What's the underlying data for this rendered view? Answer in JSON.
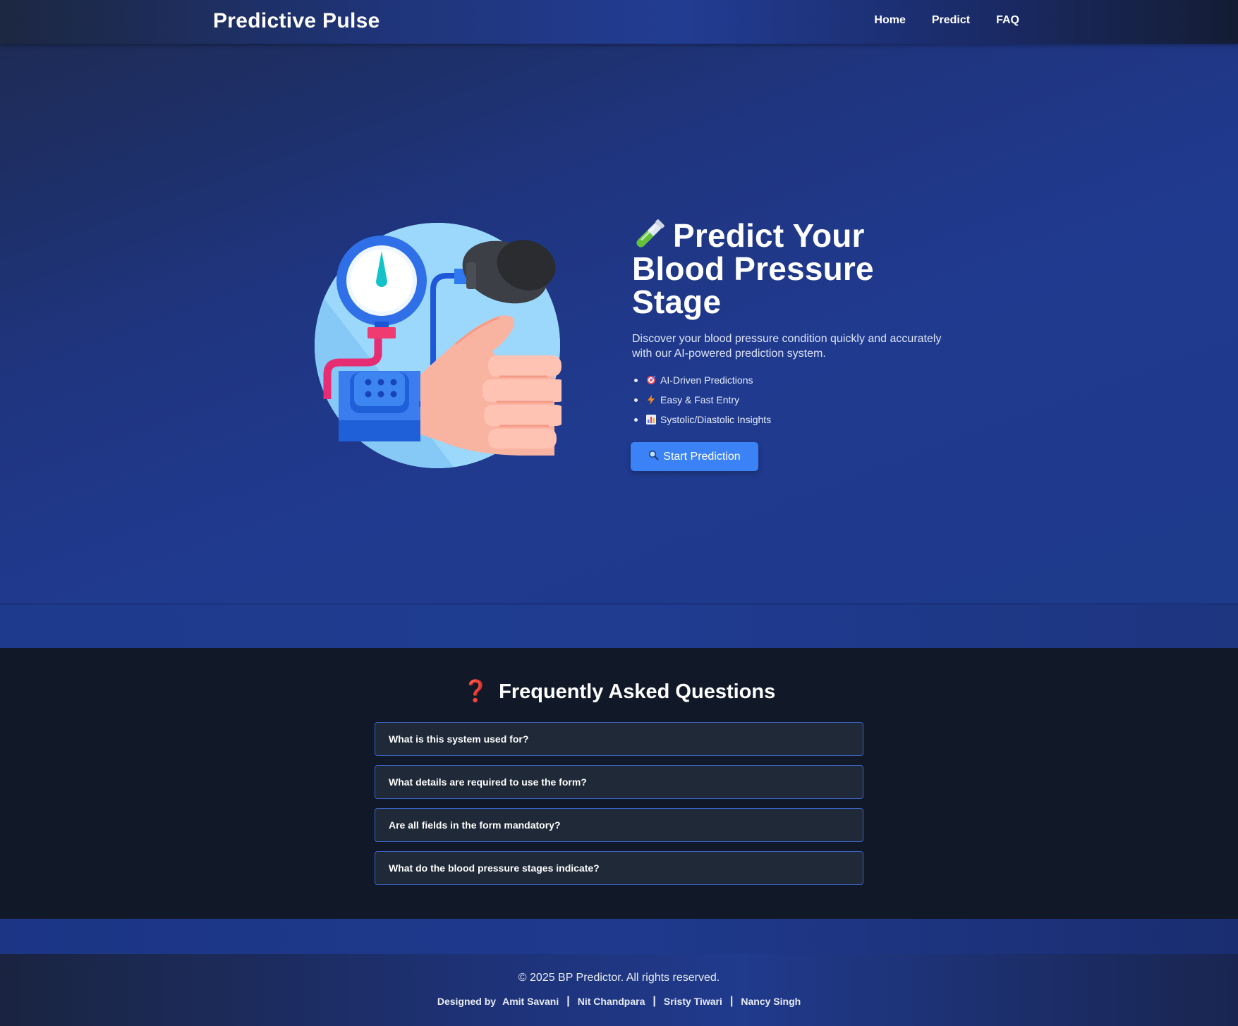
{
  "nav": {
    "brand": "Predictive Pulse",
    "links": [
      "Home",
      "Predict",
      "FAQ"
    ]
  },
  "hero": {
    "title": "Predict Your Blood Pressure Stage",
    "title_icon": "test-tube-icon",
    "description": "Discover your blood pressure condition quickly and accurately with our AI-powered prediction system.",
    "features": [
      {
        "icon": "target-icon",
        "label": "AI-Driven Predictions"
      },
      {
        "icon": "lightning-icon",
        "label": "Easy & Fast Entry"
      },
      {
        "icon": "bar-chart-icon",
        "label": "Systolic/Diastolic Insights"
      }
    ],
    "cta_icon": "magnifier-icon",
    "cta_label": "Start Prediction",
    "illustration": "blood-pressure-monitor-illustration"
  },
  "faq": {
    "icon": "question-mark-icon",
    "title": "Frequently Asked Questions",
    "questions": [
      "What is this system used for?",
      "What details are required to use the form?",
      "Are all fields in the form mandatory?",
      "What do the blood pressure stages indicate?"
    ]
  },
  "footer": {
    "copyright": "© 2025 BP Predictor. All rights reserved.",
    "designed_by_label": "Designed by",
    "designers": [
      "Amit Savani",
      "Nit Chandpara",
      "Sristy Tiwari",
      "Nancy Singh"
    ],
    "separator": "|"
  },
  "colors": {
    "accent": "#3b82f6",
    "faq_bg": "#111827",
    "faq_item_bg": "#1f2937",
    "faq_border": "#3b63c4",
    "question_icon": "#f43f5e"
  }
}
